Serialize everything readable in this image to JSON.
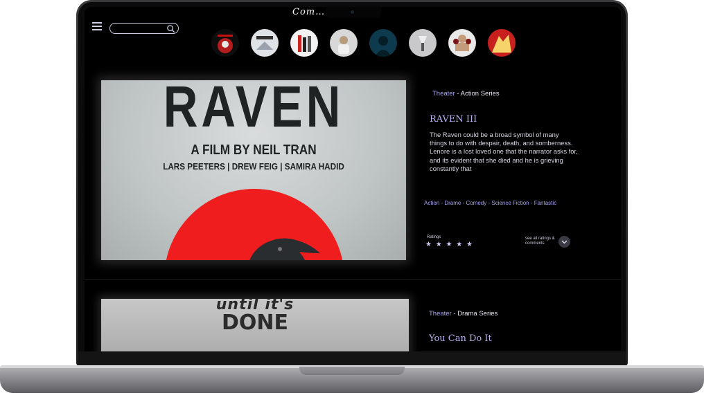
{
  "app": {
    "brand": "Com… …s"
  },
  "header": {
    "search_placeholder": ""
  },
  "stories": [
    {
      "name": "story-1",
      "color": "#b31d1d"
    },
    {
      "name": "story-2",
      "color": "#dfe3e8"
    },
    {
      "name": "story-3",
      "color": "#f2f2f2"
    },
    {
      "name": "story-4",
      "color": "#d8d8d8"
    },
    {
      "name": "story-5",
      "color": "#0e3a4d"
    },
    {
      "name": "story-6",
      "color": "#c9c9cc"
    },
    {
      "name": "story-7",
      "color": "#7a1414"
    },
    {
      "name": "story-8",
      "color": "#c8201e"
    }
  ],
  "cards": [
    {
      "poster": {
        "title": "RAVEN",
        "byline": "A FILM BY NEIL TRAN",
        "cast": "LARS PEETERS  |  DREW FEIG  |  SAMIRA HADID"
      },
      "category_prefix": "Theater",
      "category_rest": " - Action Series",
      "title": "RAVEN III",
      "description": "The Raven could be a broad symbol of many things to do with despair, death, and somberness. Lenore is a lost loved one that the narrator asks for, and its evident that she died and he is grieving constantly that",
      "genres": "Action - Drame - Comedy - Science Fiction - Fantastic",
      "ratings_label": "Ratings",
      "stars": "★ ★ ★ ★ ★",
      "see_all": "see all ratings & comments"
    },
    {
      "poster": {
        "line1": "until it's",
        "line2": "DONE"
      },
      "category_prefix": "Theater",
      "category_rest": " -  Drama Series",
      "title": "You Can Do It"
    }
  ],
  "colors": {
    "accent": "#a9a4ee",
    "background": "#000000",
    "poster_red": "#ef1d1d"
  }
}
